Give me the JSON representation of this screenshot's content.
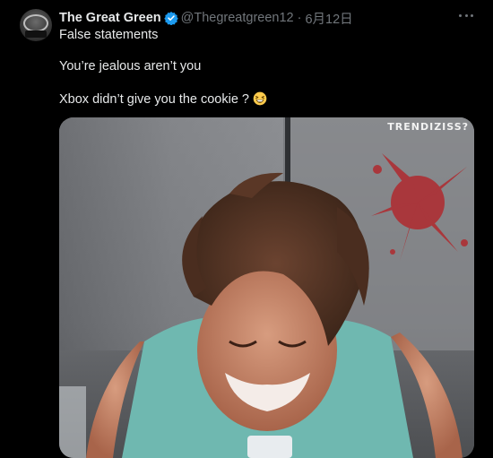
{
  "tweet": {
    "display_name": "The Great Green",
    "handle": "@Thegreatgreen12",
    "separator": "·",
    "date": "6月12日",
    "lines": [
      "False statements",
      "You’re jealous aren’t you",
      "Xbox didn’t give you the cookie ?"
    ],
    "emoji": "grinning-squinting-face",
    "verified_color": "#1d9bf0",
    "more_icon": "more-horizontal-icon"
  },
  "media": {
    "watermark": "TRENDIZISS?"
  }
}
